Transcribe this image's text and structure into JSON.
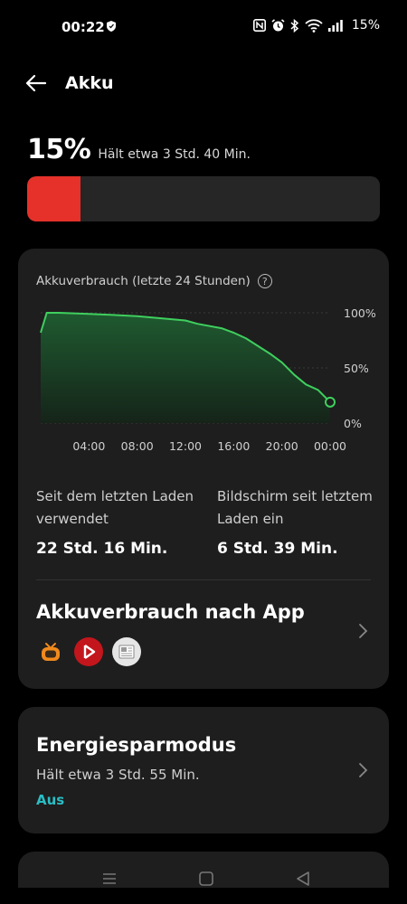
{
  "status_bar": {
    "time": "00:22",
    "battery_percent": "15%",
    "icons": [
      "vpn-shield-icon",
      "nfc-icon",
      "alarm-icon",
      "bluetooth-icon",
      "wifi-icon",
      "signal-icon"
    ]
  },
  "app_bar": {
    "title": "Akku",
    "back_icon": "arrow-left-icon"
  },
  "battery": {
    "level_text": "15%",
    "level_fraction": 0.15,
    "estimate": "Hält etwa 3 Std. 40 Min.",
    "fill_color": "#e5312a"
  },
  "usage_card": {
    "title": "Akkuverbrauch (letzte 24 Stunden)",
    "help_icon": "question-circle-icon",
    "since_charge_label": "Seit dem letzten Laden verwendet",
    "since_charge_value": "22 Std. 16 Min.",
    "screen_on_label": "Bildschirm seit letztem Laden ein",
    "screen_on_value": "6 Std. 39 Min.",
    "app_usage_title": "Akkuverbrauch nach App",
    "app_icons": [
      "tv-app-icon",
      "play-app-icon",
      "news-app-icon"
    ]
  },
  "energy_card": {
    "title": "Energiesparmodus",
    "estimate": "Hält etwa 3 Std. 55 Min.",
    "status": "Aus",
    "status_color": "#2bbdc4"
  },
  "chart_data": {
    "type": "area",
    "xlabel": "",
    "ylabel": "",
    "x_ticks": [
      "04:00",
      "08:00",
      "12:00",
      "16:00",
      "20:00",
      "00:00"
    ],
    "y_ticks": [
      "100%",
      "50%",
      "0%"
    ],
    "ylim": [
      0,
      100
    ],
    "line_color": "#3fcf5e",
    "grid": true,
    "x": [
      0.0,
      0.5,
      1.5,
      4,
      6,
      8,
      10,
      12,
      13,
      15,
      16,
      17,
      18,
      19,
      20,
      21,
      22,
      23,
      24
    ],
    "y": [
      82,
      100,
      100,
      99,
      98,
      97,
      95,
      93,
      90,
      86,
      82,
      77,
      70,
      63,
      55,
      44,
      35,
      30,
      19
    ]
  },
  "nav_bar": {
    "icons": [
      "recents-icon",
      "home-icon",
      "back-triangle-icon"
    ]
  }
}
